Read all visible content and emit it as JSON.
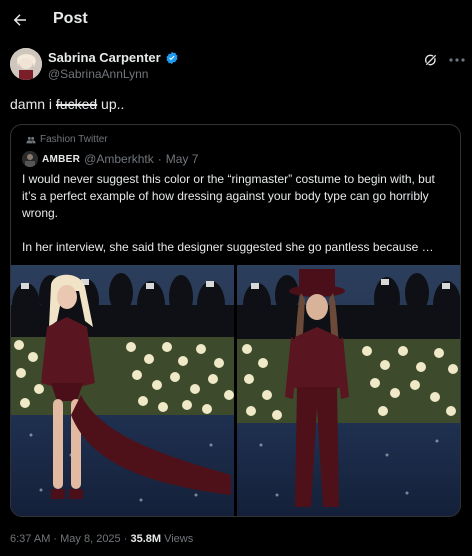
{
  "header": {
    "title": "Post"
  },
  "author": {
    "name": "Sabrina Carpenter",
    "handle": "@SabrinaAnnLynn",
    "verified": true
  },
  "post": {
    "text_before": "damn i ",
    "text_struck": "fucked",
    "text_after": " up.."
  },
  "quote": {
    "community": "Fashion Twitter",
    "author_name": "AMBER",
    "author_handle": "@Amberkhtk",
    "separator": "·",
    "date": "May 7",
    "paragraph_1": "I would never suggest this color or the “ringmaster” costume to begin with, but it’s a perfect example of how dressing against your body type can go horribly wrong.",
    "paragraph_2": "In her interview, she said the designer suggested she go pantless because …"
  },
  "meta": {
    "timestamp": "6:37 AM · May 8, 2025 · ",
    "views_count": "35.8M",
    "views_label": " Views"
  },
  "icons": [
    "back-arrow-icon",
    "verified-badge-icon",
    "grok-icon",
    "more-icon",
    "community-icon"
  ],
  "colors": {
    "background": "#000000",
    "text": "#e7e9ea",
    "secondary": "#71767b",
    "verified": "#1d9bf0",
    "border": "#2f3336"
  }
}
